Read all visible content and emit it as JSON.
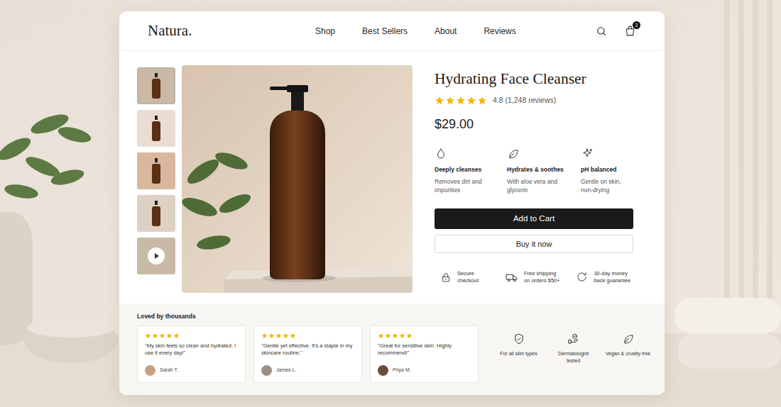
{
  "brand": {
    "logo": "Natura."
  },
  "nav": [
    "Shop",
    "Best Sellers",
    "About",
    "Reviews"
  ],
  "cart": {
    "count": "2"
  },
  "gallery": {
    "thumbnails": [
      {
        "kind": "image",
        "selected": true
      },
      {
        "kind": "image",
        "selected": false
      },
      {
        "kind": "image",
        "selected": false
      },
      {
        "kind": "image",
        "selected": false
      },
      {
        "kind": "video",
        "selected": false
      }
    ]
  },
  "product": {
    "title": "Hydrating Face Cleanser",
    "stars": 5,
    "rating": "4.8 (1,248 reviews)",
    "price": "$29.00"
  },
  "features": [
    {
      "title": "Deeply cleanses",
      "text": "Removes dirt and impurities"
    },
    {
      "title": "Hydrates & soothes",
      "text": "With aloe vera and glycerin"
    },
    {
      "title": "pH balanced",
      "text": "Gentle on skin, non-drying"
    }
  ],
  "actions": [
    "Add to Cart",
    "Buy it now"
  ],
  "trust": [
    "Secure checkout",
    "Free shipping on orders $50+",
    "30-day money back guarantee"
  ],
  "reviews": {
    "title": "Loved by thousands",
    "items": [
      {
        "stars": 5,
        "quote": "\"My skin feels so clean and hydrated. I use it every day!\"",
        "author": "Sarah T."
      },
      {
        "stars": 5,
        "quote": "\"Gentle yet effective. It's a staple in my skincare routine.\"",
        "author": "James L."
      },
      {
        "stars": 5,
        "quote": "\"Great for sensitive skin. Highly recommend!\"",
        "author": "Priya M."
      }
    ]
  },
  "badges": [
    "For all skin types",
    "Dermatologist tested",
    "Vegan & cruelty-free"
  ]
}
